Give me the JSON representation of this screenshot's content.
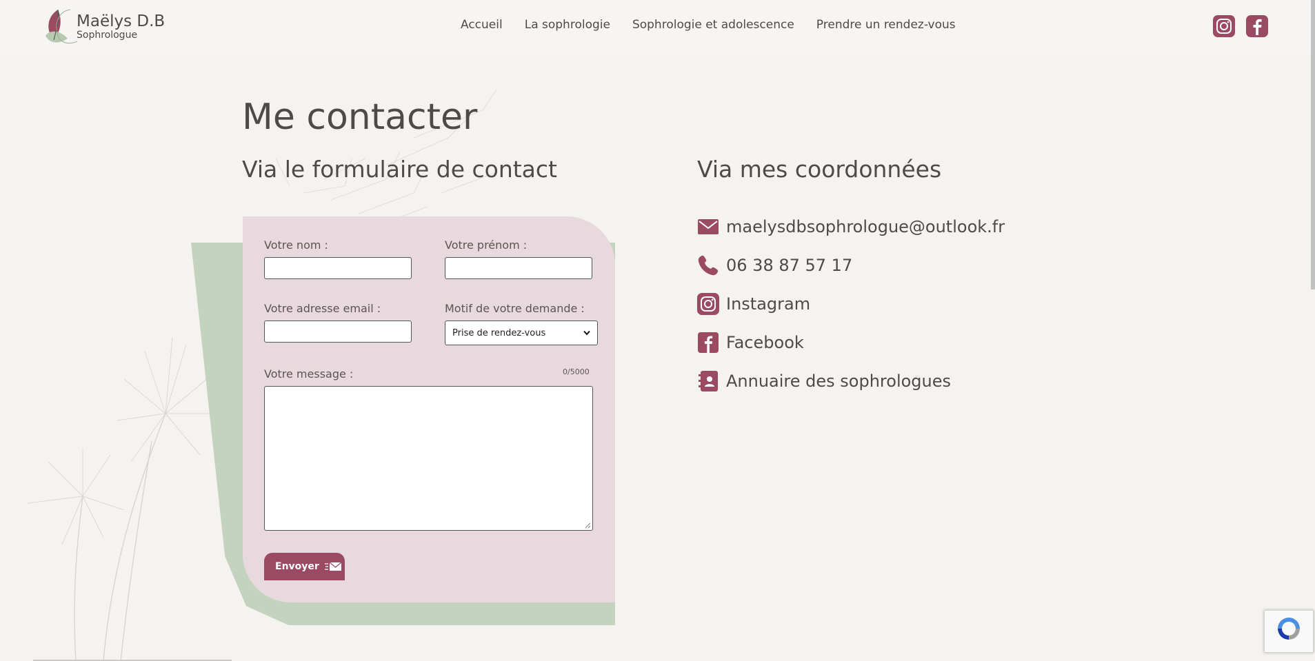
{
  "header": {
    "logo_title": "Maëlys D.B",
    "logo_subtitle": "Sophrologue",
    "nav": [
      "Accueil",
      "La sophrologie",
      "Sophrologie et adolescence",
      "Prendre un rendez-vous"
    ],
    "social_icons": [
      "instagram-icon",
      "facebook-icon"
    ]
  },
  "main": {
    "title": "Me contacter",
    "form_heading": "Via le formulaire de contact",
    "contact_heading": "Via mes coordonnées"
  },
  "form": {
    "last_name_label": "Votre nom :",
    "first_name_label": "Votre prénom :",
    "email_label": "Votre adresse email :",
    "reason_label": "Motif de votre demande :",
    "reason_selected": "Prise de rendez-vous",
    "message_label": "Votre message :",
    "message_counter": "0/5000",
    "send_label": "Envoyer"
  },
  "contacts": [
    {
      "icon": "mail-icon",
      "text": "maelysdbsophrologue@outlook.fr"
    },
    {
      "icon": "phone-icon",
      "text": "06 38 87 57 17"
    },
    {
      "icon": "instagram-icon",
      "text": "Instagram"
    },
    {
      "icon": "facebook-icon",
      "text": "Facebook"
    },
    {
      "icon": "address-book-icon",
      "text": "Annuaire des sophrologues"
    }
  ],
  "colors": {
    "accent": "#9b4a64",
    "background": "#f5f3f0",
    "form_card": "#e8d9de",
    "green_shape": "#c4d3bd",
    "text": "#4e4a47"
  }
}
